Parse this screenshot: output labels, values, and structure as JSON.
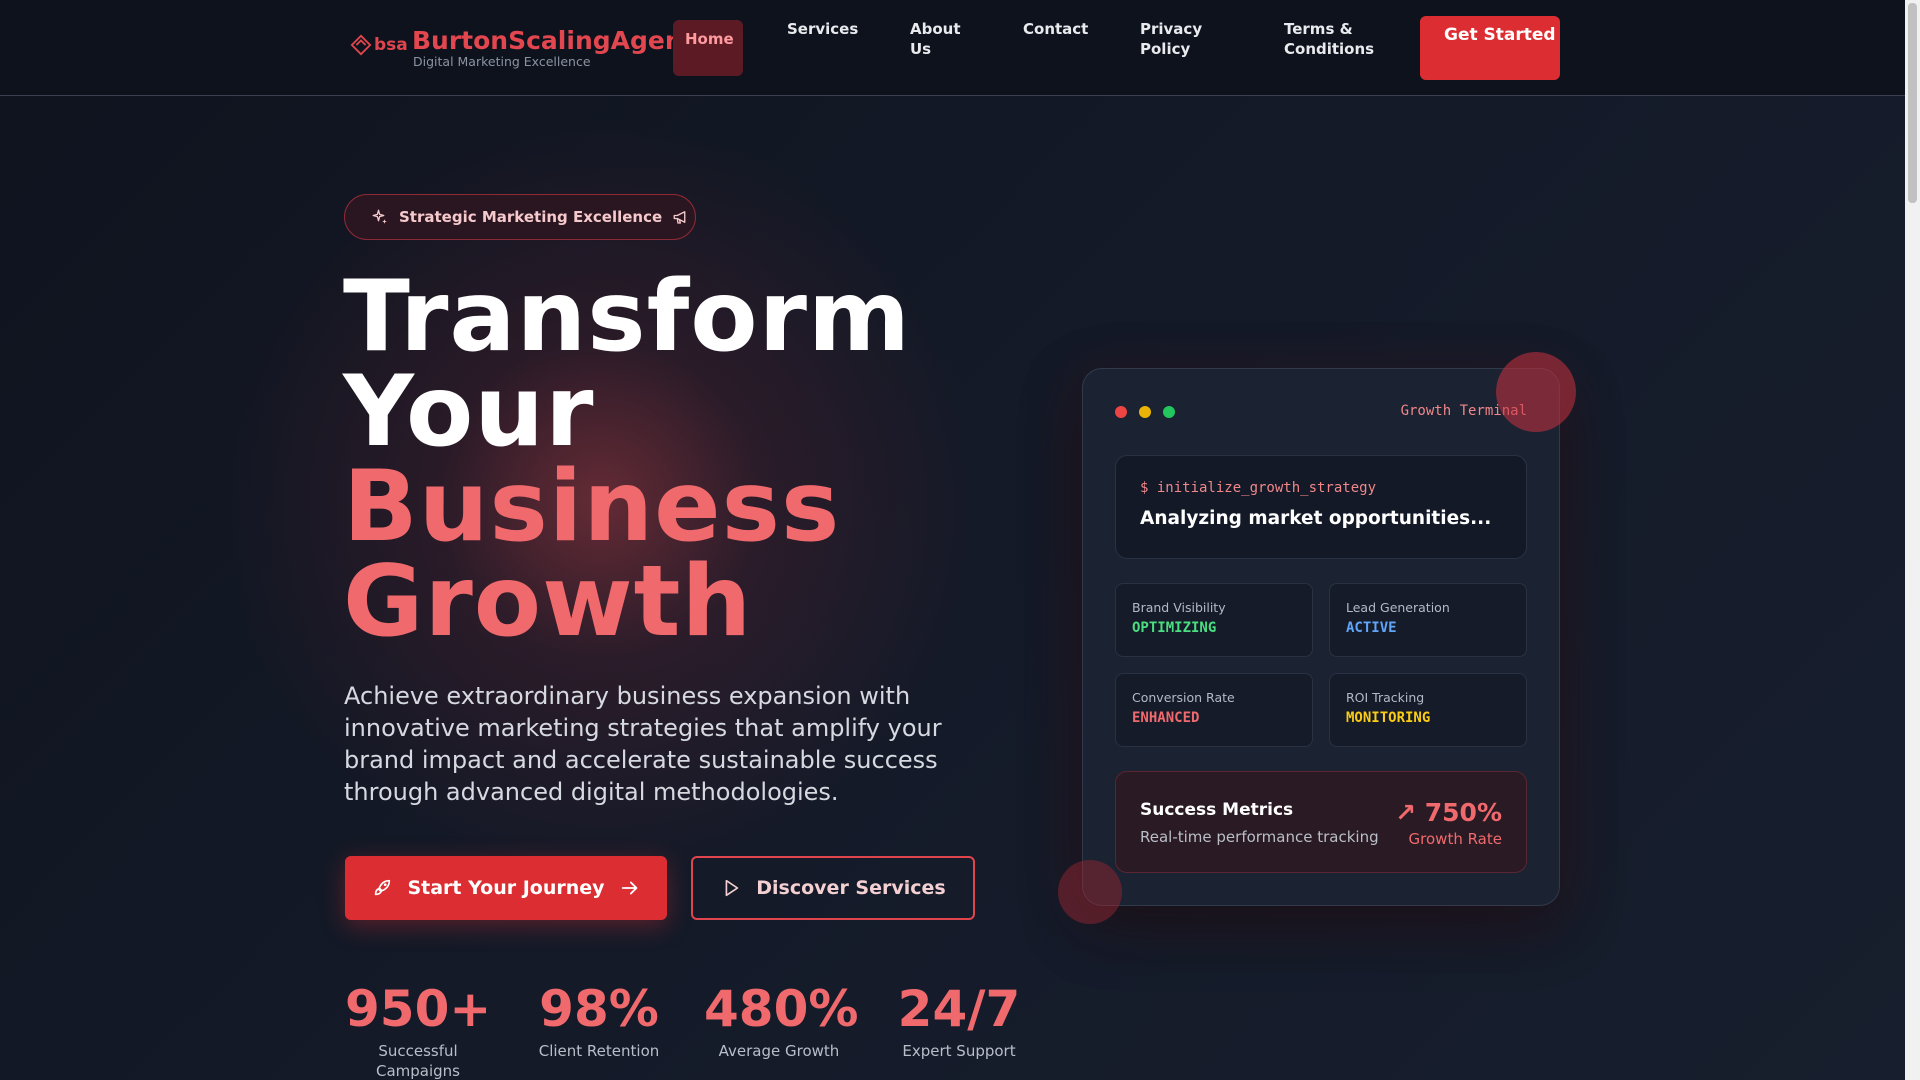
{
  "header": {
    "logo_text": "bsa",
    "brand_name": "BurtonScalingAgency",
    "tagline": "Digital Marketing Excellence",
    "nav": [
      {
        "label": "Home",
        "active": true
      },
      {
        "label": "Services"
      },
      {
        "label": "About Us"
      },
      {
        "label": "Contact"
      },
      {
        "label": "Privacy Policy"
      },
      {
        "label": "Terms & Conditions"
      }
    ],
    "cta_label": "Get Started"
  },
  "hero": {
    "badge": {
      "label": "Strategic Marketing Excellence",
      "icon_left": "sparkles-icon",
      "icon_right": "megaphone-icon"
    },
    "title_line1": "Transform",
    "title_line2": "Your",
    "title_line3": "Business",
    "title_line4": "Growth",
    "description": "Achieve extraordinary business expansion with innovative marketing strategies that amplify your brand impact and accelerate sustainable success through advanced digital methodologies.",
    "primary_button": {
      "label": "Start Your Journey",
      "icon": "rocket-icon",
      "trailing_icon": "arrow-right-icon"
    },
    "secondary_button": {
      "label": "Discover Services",
      "icon": "play-icon"
    },
    "stats": [
      {
        "value": "950+",
        "label": "Successful Campaigns"
      },
      {
        "value": "98%",
        "label": "Client Retention"
      },
      {
        "value": "480%",
        "label": "Average Growth"
      },
      {
        "value": "24/7",
        "label": "Expert Support"
      }
    ]
  },
  "terminal": {
    "title": "Growth Terminal",
    "command": "$ initialize_growth_strategy",
    "output": "Analyzing market opportunities...",
    "metrics": [
      {
        "label": "Brand Visibility",
        "status": "OPTIMIZING",
        "color": "#4ade80"
      },
      {
        "label": "Lead Generation",
        "status": "ACTIVE",
        "color": "#60a5fa"
      },
      {
        "label": "Conversion Rate",
        "status": "ENHANCED",
        "color": "#f06a6d"
      },
      {
        "label": "ROI Tracking",
        "status": "MONITORING",
        "color": "#facc15"
      }
    ],
    "success": {
      "title": "Success Metrics",
      "subtitle": "Real-time performance tracking",
      "value": "↗ 750%",
      "label": "Growth Rate"
    }
  },
  "colors": {
    "accent": "#dc2e32",
    "accent_light": "#f06a6d",
    "background": "#111623"
  }
}
